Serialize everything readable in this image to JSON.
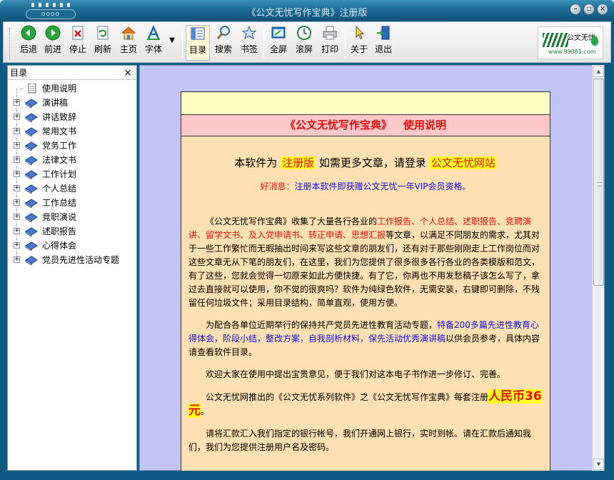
{
  "window": {
    "title": "《公文无忧写作宝典》注册版",
    "logo_text": "oooo"
  },
  "toolbar": {
    "buttons": [
      {
        "label": "后退",
        "icon": "back-arrow-icon"
      },
      {
        "label": "前进",
        "icon": "forward-arrow-icon"
      },
      {
        "label": "停止",
        "icon": "stop-icon"
      },
      {
        "label": "刷新",
        "icon": "refresh-icon"
      },
      {
        "label": "主页",
        "icon": "home-icon"
      },
      {
        "label": "字体",
        "icon": "font-icon"
      },
      {
        "label": "目录",
        "icon": "contents-icon"
      },
      {
        "label": "搜索",
        "icon": "search-icon"
      },
      {
        "label": "书签",
        "icon": "bookmark-star-icon"
      },
      {
        "label": "全屏",
        "icon": "fullscreen-icon"
      },
      {
        "label": "滚屏",
        "icon": "autoscroll-clock-icon"
      },
      {
        "label": "打印",
        "icon": "printer-icon"
      },
      {
        "label": "关于",
        "icon": "pointer-icon"
      },
      {
        "label": "退出",
        "icon": "exit-door-icon"
      }
    ],
    "brand": {
      "name": "公文无忧",
      "url": "www.99081.com"
    }
  },
  "sidebar": {
    "title": "目录",
    "close": "×",
    "items": [
      {
        "label": "使用说明",
        "type": "page"
      },
      {
        "label": "演讲稿",
        "type": "folder"
      },
      {
        "label": "讲话致辞",
        "type": "folder"
      },
      {
        "label": "常用文书",
        "type": "folder"
      },
      {
        "label": "党务工作",
        "type": "folder"
      },
      {
        "label": "法律文书",
        "type": "folder"
      },
      {
        "label": "工作计划",
        "type": "folder"
      },
      {
        "label": "个人总结",
        "type": "folder"
      },
      {
        "label": "工作总结",
        "type": "folder"
      },
      {
        "label": "竞职演说",
        "type": "folder"
      },
      {
        "label": "述职报告",
        "type": "folder"
      },
      {
        "label": "心得体会",
        "type": "folder"
      },
      {
        "label": "党员先进性活动专题",
        "type": "folder"
      }
    ]
  },
  "document": {
    "title_left": "《公文无忧写作宝典》",
    "title_right": "使用说明",
    "reg_prefix": "本软件为",
    "reg_edition": "注册版",
    "reg_middle": "如需更多文章，请登录",
    "reg_site": "公文无忧网站",
    "news_label": "好消息：",
    "news_text": "注册本软件即获赠公文无忧一年VIP会员资格。",
    "p1_a": "《公文无忧写作宝典》收集了大量各行各业的",
    "p1_red": "工作报告、个人总结、述职报告、竞聘演讲、留学文书、及入党申请书、转正申请、思想汇报",
    "p1_b": "等文章，以满足不同朋友的需求，尤其对于一些工作繁忙而无暇抽出时间来写这些文章的朋友们，还有对于那些刚刚走上工作岗位而对这些文章无从下笔的朋友们，在这里，我们为您提供了很多很多各行各业的各类模版和范文，有了这些，您就会觉得一切原来如此方便快捷。有了它，你再也不用发愁稿子该怎么写了，拿过去直接就可以使用，你不觉的很爽吗？软件为纯绿色软件，无需安装，右键即可删除，不残留任何垃圾文件；采用目录结构，简单直观，使用方便。",
    "p2_a": "为配合各单位近期举行的保持共产党员先进性教育活动专题，",
    "p2_blue": "特备200多篇先进性教育心得体会，阶段小结，整改方案，自我剖析材料，保先活动优秀演讲稿",
    "p2_b": "以供会员参考，具体内容请查看软件目录。",
    "p3": "欢迎大家在使用中提出宝贵意见，便于我们对这本电子书作进一步修订、完善。",
    "p4_a": "公文无忧网推出的《公文无忧系列软件》之《公文无忧写作宝典》每套注册",
    "p4_price": "人民币36元",
    "p4_b": "。",
    "p5": "请将汇款汇入我们指定的银行帐号，我们开通网上银行，实时到帐。请在汇款后通知我们，我们为您提供注册用户名及密码。"
  },
  "colors": {
    "titlebar": "#1c6c95",
    "content_bg": "#c2c4f6",
    "doc_bg": "#fee0b2",
    "doc_header": "#ffffc2",
    "doc_title_bg": "#ffc8c8",
    "accent_red": "#e01010",
    "accent_blue": "#1010e0",
    "highlight_yellow": "#ffff20"
  }
}
